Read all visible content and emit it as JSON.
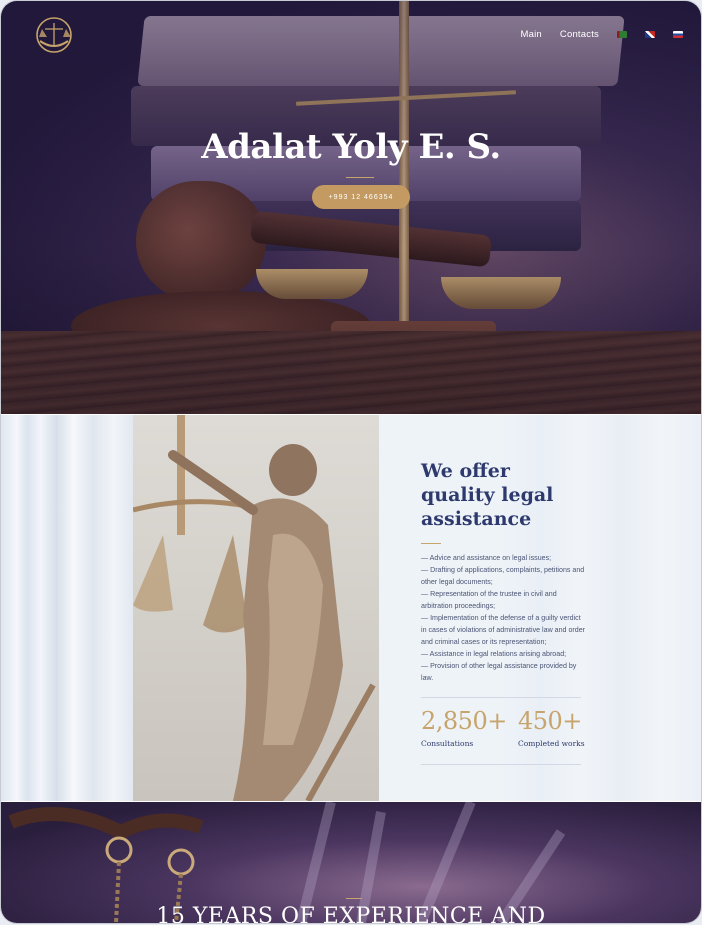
{
  "nav": {
    "main": "Main",
    "contacts": "Contacts",
    "languages": [
      {
        "code": "tm",
        "color": "#2e7d32"
      },
      {
        "code": "en",
        "color": "#1f3a8a"
      },
      {
        "code": "ru",
        "color": "#d32f2f"
      }
    ]
  },
  "hero": {
    "title": "Adalat Yoly E. S.",
    "phone": "+993 12 466354"
  },
  "services": {
    "heading": "We offer quality legal assistance",
    "items": [
      "— Advice and assistance on legal issues;",
      "— Drafting of applications, complaints, petitions and other legal documents;",
      "— Representation of the trustee in civil and arbitration proceedings;",
      "— Implementation of the defense of a guilty verdict in cases of violations of administrative law and order and criminal cases or its representation;",
      "— Assistance in legal relations arising abroad;",
      "— Provision of other legal assistance provided by law."
    ],
    "stats": [
      {
        "value": "2,850+",
        "label": "Consultations"
      },
      {
        "value": "450+",
        "label": "Completed works"
      }
    ]
  },
  "experience": {
    "title": "15 YEARS OF EXPERIENCE AND"
  },
  "colors": {
    "accent": "#c39b62",
    "navy": "#2e3a6e"
  }
}
